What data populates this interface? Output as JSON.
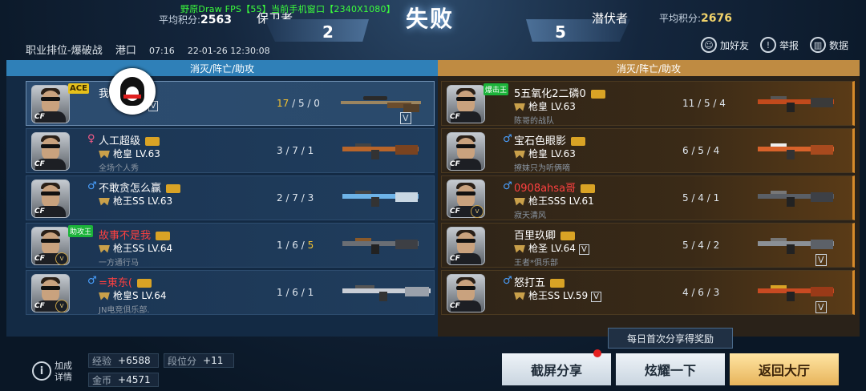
{
  "overlay": "野原Draw FPS【55】当前手机窗口【2340X1080】",
  "header": {
    "left_avg_label": "平均积分:",
    "left_avg_value": "2563",
    "left_team": "保卫者",
    "left_score": "2",
    "result": "失败",
    "right_score": "5",
    "right_team": "潜伏者",
    "right_avg_label": "平均积分:",
    "right_avg_value": "2676"
  },
  "info": {
    "mode": "职业排位-爆破战",
    "map": "港口",
    "duration": "07:16",
    "datetime": "22-01-26 12:30:08"
  },
  "top_buttons": {
    "add_friend": "加好友",
    "report": "举报",
    "data": "数据"
  },
  "columns": {
    "left_header": "消灭/阵亡/助攻",
    "right_header": "消灭/阵亡/助攻"
  },
  "left_players": [
    {
      "name": "我",
      "name_tail": "q",
      "tag": "ACE",
      "rank": "",
      "rank_tail": "3",
      "sub": "",
      "kda_k": "17",
      "kda_rest": "/ 5 / 0"
    },
    {
      "name": "人工超级",
      "gender": "♀",
      "rank": "枪皇 LV.63",
      "sub": "全场个人秀",
      "kda": "3 / 7 / 1"
    },
    {
      "name": "不敢贪怎么赢",
      "gender": "♂",
      "rank": "枪王SS LV.63",
      "sub": "",
      "kda": "2 / 7 / 3"
    },
    {
      "name": "故事不是我",
      "gender": "",
      "tag": "助攻王",
      "rank": "枪王SS LV.64",
      "sub": "一方通行马",
      "kda_pre": "1 / 6 / ",
      "kda_a": "5"
    },
    {
      "name": "=東东(",
      "gender": "♂",
      "rank": "枪皇S LV.64",
      "sub": "JN电竞俱乐部.",
      "kda": "1 / 6 / 1"
    }
  ],
  "right_players": [
    {
      "name": "5五氧化2二磷0",
      "tag": "爆击王",
      "rank": "枪皇 LV.63",
      "sub": "陈哥的战队",
      "kda": "11 / 5 / 4"
    },
    {
      "name": "宝石色眼影",
      "gender": "♂",
      "rank": "枪皇 LV.63",
      "sub": "撩妹只为听俩嘀",
      "kda": "6 / 5 / 4"
    },
    {
      "name": "0908ahsa哥",
      "gender": "♂",
      "rank": "枪王SSS LV.61",
      "sub": "寂天清风",
      "kda": "5 / 4 / 1"
    },
    {
      "name": "百里玖卿",
      "gender": "",
      "rank": "枪圣 LV.64",
      "sub": "王者*俱乐部",
      "kda": "5 / 4 / 2"
    },
    {
      "name": "怒打五",
      "gender": "♂",
      "rank": "枪王SS LV.59",
      "sub": "",
      "kda": "4 / 6 / 3"
    }
  ],
  "bottom": {
    "bonus_line1": "加成",
    "bonus_line2": "详情",
    "exp_label": "经验",
    "exp_value": "+6588",
    "rank_label": "段位分",
    "rank_value": "+11",
    "gold_label": "金币",
    "gold_value": "+4571",
    "share_banner": "每日首次分享得奖励",
    "btn_screenshot": "截屏分享",
    "btn_show": "炫耀一下",
    "btn_back": "返回大厅"
  },
  "colors": {
    "left_header": "#2f80b8",
    "right_header": "#bf8b42",
    "gold_button": "#e7b45b",
    "highlight": "#f4c230"
  }
}
